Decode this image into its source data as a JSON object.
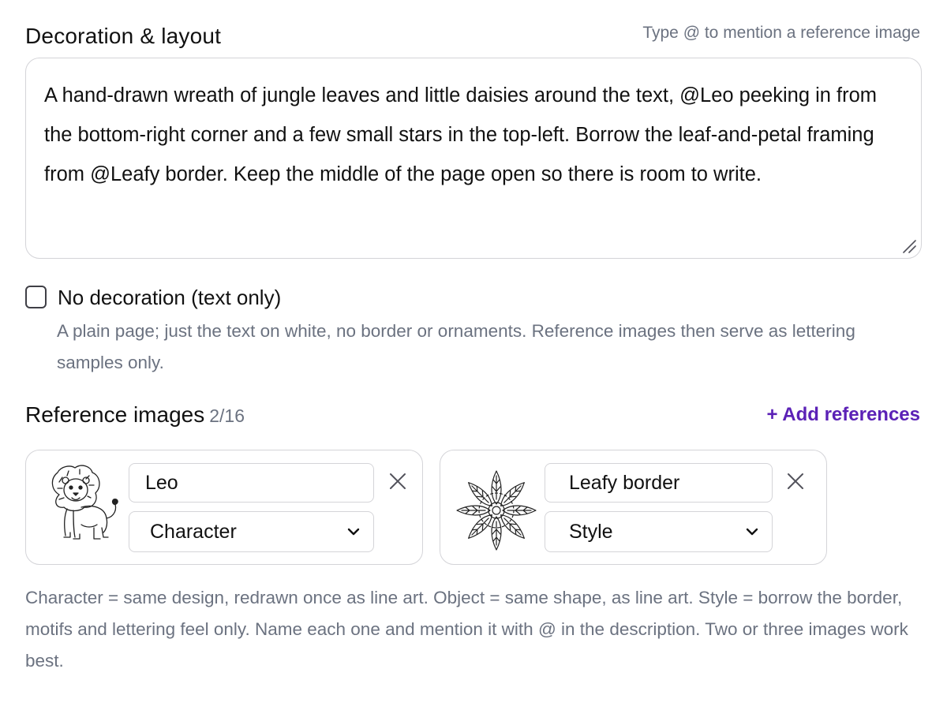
{
  "decoration": {
    "title": "Decoration & layout",
    "hint": "Type @ to mention a reference image",
    "description": "A hand-drawn wreath of jungle leaves and little daisies around the text, @Leo peeking in from the bottom-right corner and a few small stars in the top-left. Borrow the leaf-and-petal framing from @Leafy border. Keep the middle of the page open so there is room to write."
  },
  "no_decoration": {
    "label": "No decoration (text only)",
    "checked": false,
    "help": "A plain page; just the text on white, no border or ornaments. Reference images then serve as lettering samples only."
  },
  "references": {
    "title": "Reference images",
    "count": "2/16",
    "add_label": "+ Add references",
    "items": [
      {
        "name": "Leo",
        "type": "Character",
        "thumbnail_icon": "lion-line-art-icon"
      },
      {
        "name": "Leafy border",
        "type": "Style",
        "thumbnail_icon": "mandala-line-art-icon"
      }
    ],
    "help": "Character = same design, redrawn once as line art. Object = same shape, as line art. Style = borrow the border, motifs and lettering feel only. Name each one and mention it with @ in the description. Two or three images work best."
  },
  "colors": {
    "accent": "#5b21b6",
    "muted_text": "#6b7280",
    "border": "#d4d4d8"
  }
}
